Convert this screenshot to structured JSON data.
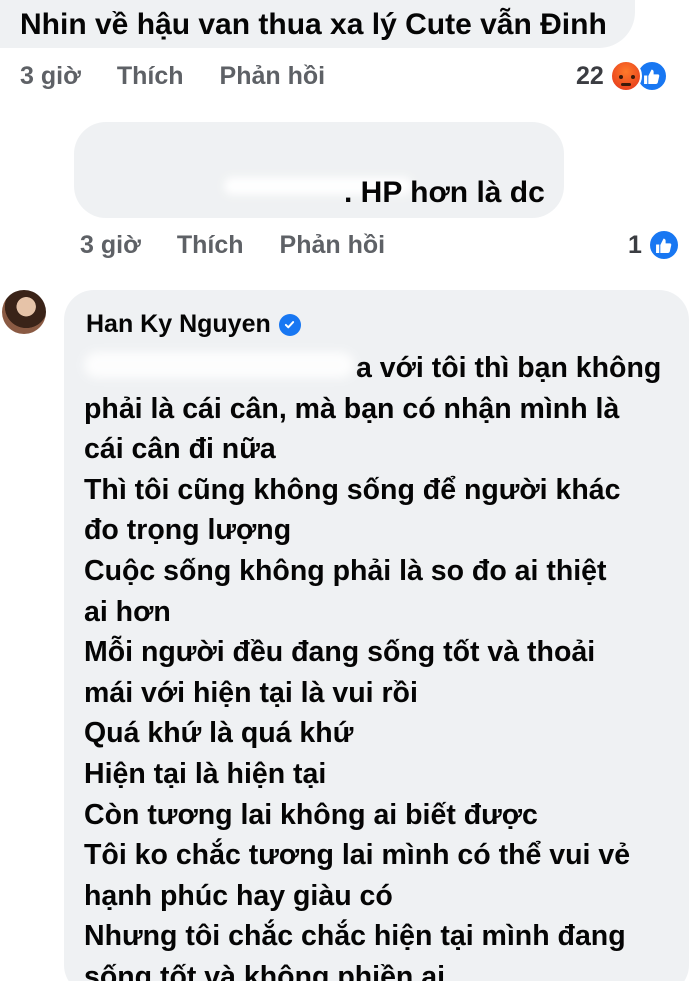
{
  "comments": [
    {
      "text": "Nhin về hậu van thua xa lý Cute vẫn Đinh",
      "time": "3 giờ",
      "like_label": "Thích",
      "reply_label": "Phản hồi",
      "reaction_count": "22",
      "reactions": [
        "angry-icon",
        "like-icon"
      ]
    },
    {
      "text": ". HP hơn là dc",
      "time": "3 giờ",
      "like_label": "Thích",
      "reply_label": "Phản hồi",
      "reaction_count": "1",
      "reactions": [
        "like-icon"
      ]
    },
    {
      "author": "Han Ky Nguyen",
      "verified": true,
      "lines": [
        "a với tôi thì bạn không",
        "phải là cái cân, mà bạn có nhận mình là",
        "cái cân đi nữa",
        "Thì tôi cũng không sống để người khác",
        "đo trọng lượng",
        "Cuộc sống không phải là so đo ai thiệt",
        "ai hơn",
        "Mỗi người đều đang sống tốt và thoải",
        "mái với hiện tại là vui rồi",
        "Quá khứ là quá khứ",
        "Hiện tại là hiện tại",
        "Còn tương lai không ai biết được",
        "Tôi ko chắc tương lai mình có thể vui vẻ",
        "hạnh phúc hay giàu có",
        "Nhưng tôi chắc chắc hiện tại mình đang",
        "sống tốt và không phiền ai."
      ]
    }
  ],
  "colors": {
    "bubble": "#eff1f3",
    "meta": "#5e6166",
    "accent": "#1877f2"
  }
}
